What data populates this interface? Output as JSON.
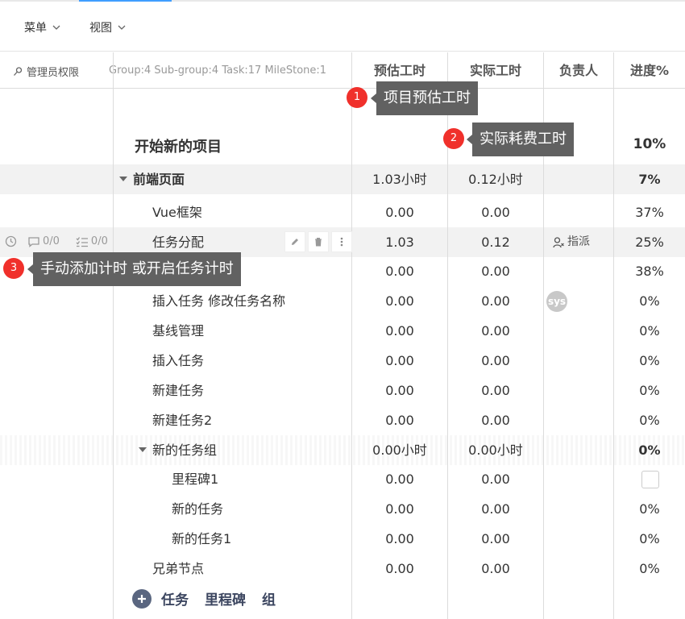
{
  "toolbar": {
    "menu_label": "菜单",
    "view_label": "视图"
  },
  "header": {
    "admin_label": "管理员权限",
    "summary": "Group:4 Sub-group:4 Task:17 MileStone:1",
    "columns": [
      "预估工时",
      "实际工时",
      "负责人",
      "进度%"
    ]
  },
  "project": {
    "title": "开始新的项目",
    "progress": "10%"
  },
  "tooltips": [
    {
      "badge": "1",
      "text": "项目预估工时"
    },
    {
      "badge": "2",
      "text": "实际耗费工时"
    },
    {
      "badge": "3",
      "text": "手动添加计时 或开启任务计时"
    }
  ],
  "rows": [
    {
      "name": "前端页面",
      "est": "1.03小时",
      "act": "0.12小时",
      "progress": "7%"
    },
    {
      "name": "Vue框架",
      "est": "0.00",
      "act": "0.00",
      "progress": "37%"
    },
    {
      "name": "任务分配",
      "est": "1.03",
      "act": "0.12",
      "progress": "25%"
    },
    {
      "name": "",
      "est": "0.00",
      "act": "0.00",
      "progress": "38%"
    },
    {
      "name": "插入任务 修改任务名称",
      "est": "0.00",
      "act": "0.00",
      "progress": "0%"
    },
    {
      "name": "基线管理",
      "est": "0.00",
      "act": "0.00",
      "progress": "0%"
    },
    {
      "name": "插入任务",
      "est": "0.00",
      "act": "0.00",
      "progress": "0%"
    },
    {
      "name": "新建任务",
      "est": "0.00",
      "act": "0.00",
      "progress": "0%"
    },
    {
      "name": "新建任务2",
      "est": "0.00",
      "act": "0.00",
      "progress": "0%"
    },
    {
      "name": "新的任务组",
      "est": "0.00小时",
      "act": "0.00小时",
      "progress": "0%"
    },
    {
      "name": "里程碑1",
      "est": "0.00",
      "act": "0.00",
      "progress": ""
    },
    {
      "name": "新的任务",
      "est": "0.00",
      "act": "0.00",
      "progress": "0%"
    },
    {
      "name": "新的任务1",
      "est": "0.00",
      "act": "0.00",
      "progress": "0%"
    },
    {
      "name": "兄弟节点",
      "est": "0.00",
      "act": "0.00",
      "progress": "0%"
    }
  ],
  "row_meta": {
    "comments": "0/0",
    "checklist": "0/0",
    "assign_label": "指派",
    "avatar_text": "sys"
  },
  "add_bar": {
    "task": "任务",
    "milestone": "里程碑",
    "group": "组"
  }
}
